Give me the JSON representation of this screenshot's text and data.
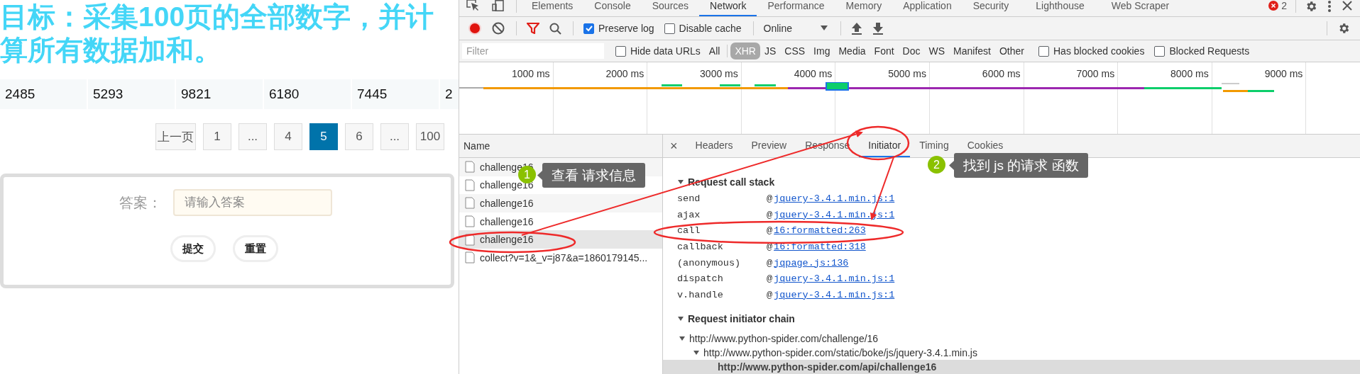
{
  "page": {
    "heading": "目标：采集100页的全部数字，并计算所有数据加和。",
    "numbers": [
      "2485",
      "5293",
      "9821",
      "6180",
      "7445",
      "2"
    ],
    "pagination": [
      {
        "label": "上一页",
        "selected": false
      },
      {
        "label": "1",
        "selected": false
      },
      {
        "label": "...",
        "selected": false
      },
      {
        "label": "4",
        "selected": false
      },
      {
        "label": "5",
        "selected": true
      },
      {
        "label": "6",
        "selected": false
      },
      {
        "label": "...",
        "selected": false
      },
      {
        "label": "100",
        "selected": false
      }
    ],
    "answer": {
      "label": "答案：",
      "placeholder": "请输入答案"
    },
    "buttons": [
      "提交",
      "重置"
    ]
  },
  "devtools": {
    "panel_tabs": [
      {
        "label": "Elements",
        "selected": false
      },
      {
        "label": "Console",
        "selected": false
      },
      {
        "label": "Sources",
        "selected": false
      },
      {
        "label": "Network",
        "selected": true
      },
      {
        "label": "Performance",
        "selected": false
      },
      {
        "label": "Memory",
        "selected": false
      },
      {
        "label": "Application",
        "selected": false
      },
      {
        "label": "Security",
        "selected": false
      },
      {
        "label": "Lighthouse",
        "selected": false
      },
      {
        "label": "Web Scraper",
        "selected": false
      }
    ],
    "error_count": "2",
    "toolbar": {
      "recording": true,
      "filter_active": true,
      "preserve_log": {
        "label": "Preserve log",
        "checked": true
      },
      "disable_cache": {
        "label": "Disable cache",
        "checked": false
      },
      "throttling": "Online"
    },
    "filter_bar": {
      "placeholder": "Filter",
      "hide_data_urls": {
        "label": "Hide data URLs",
        "checked": false
      },
      "types": [
        {
          "label": "All",
          "selected": false
        },
        {
          "label": "XHR",
          "selected": true
        },
        {
          "label": "JS",
          "selected": false
        },
        {
          "label": "CSS",
          "selected": false
        },
        {
          "label": "Img",
          "selected": false
        },
        {
          "label": "Media",
          "selected": false
        },
        {
          "label": "Font",
          "selected": false
        },
        {
          "label": "Doc",
          "selected": false
        },
        {
          "label": "WS",
          "selected": false
        },
        {
          "label": "Manifest",
          "selected": false
        },
        {
          "label": "Other",
          "selected": false
        }
      ],
      "has_blocked_cookies": {
        "label": "Has blocked cookies",
        "checked": false
      },
      "blocked_requests": {
        "label": "Blocked Requests",
        "checked": false
      }
    },
    "timeline": {
      "ticks": [
        "1000 ms",
        "2000 ms",
        "3000 ms",
        "4000 ms",
        "5000 ms",
        "6000 ms",
        "7000 ms",
        "8000 ms",
        "9000 ms"
      ]
    },
    "requests": {
      "header": "Name",
      "rows": [
        {
          "name": "challenge16",
          "selected": false
        },
        {
          "name": "challenge16",
          "selected": false
        },
        {
          "name": "challenge16",
          "selected": false
        },
        {
          "name": "challenge16",
          "selected": false
        },
        {
          "name": "challenge16",
          "selected": true
        },
        {
          "name": "collect?v=1&_v=j87&a=1860179145...",
          "selected": false
        }
      ]
    },
    "detail": {
      "close": "×",
      "tabs": [
        {
          "label": "Headers",
          "selected": false
        },
        {
          "label": "Preview",
          "selected": false
        },
        {
          "label": "Response",
          "selected": false
        },
        {
          "label": "Initiator",
          "selected": true
        },
        {
          "label": "Timing",
          "selected": false
        },
        {
          "label": "Cookies",
          "selected": false
        }
      ],
      "call_stack": {
        "title": "Request call stack",
        "expanded": true,
        "frames": [
          {
            "function": "send",
            "at": "@",
            "location": "jquery-3.4.1.min.js:1"
          },
          {
            "function": "ajax",
            "at": "@",
            "location": "jquery-3.4.1.min.js:1"
          },
          {
            "function": "call",
            "at": "@",
            "location": "16:formatted:263"
          },
          {
            "function": "callback",
            "at": "@",
            "location": "16:formatted:318"
          },
          {
            "function": "(anonymous)",
            "at": "@",
            "location": "jqpage.js:136"
          },
          {
            "function": "dispatch",
            "at": "@",
            "location": "jquery-3.4.1.min.js:1"
          },
          {
            "function": "v.handle",
            "at": "@",
            "location": "jquery-3.4.1.min.js:1"
          }
        ]
      },
      "initiator_chain": {
        "title": "Request initiator chain",
        "expanded": true,
        "nodes": [
          {
            "url": "http://www.python-spider.com/challenge/16",
            "expanded": true,
            "selected": false,
            "children": [
              {
                "url": "http://www.python-spider.com/static/boke/js/jquery-3.4.1.min.js",
                "expanded": true,
                "selected": false,
                "children": [
                  {
                    "url": "http://www.python-spider.com/api/challenge16",
                    "selected": true
                  }
                ]
              }
            ]
          }
        ]
      }
    }
  },
  "annotations": [
    {
      "number": "1",
      "text": "查看 请求信息"
    },
    {
      "number": "2",
      "text": "找到 js 的请求 函数"
    }
  ]
}
